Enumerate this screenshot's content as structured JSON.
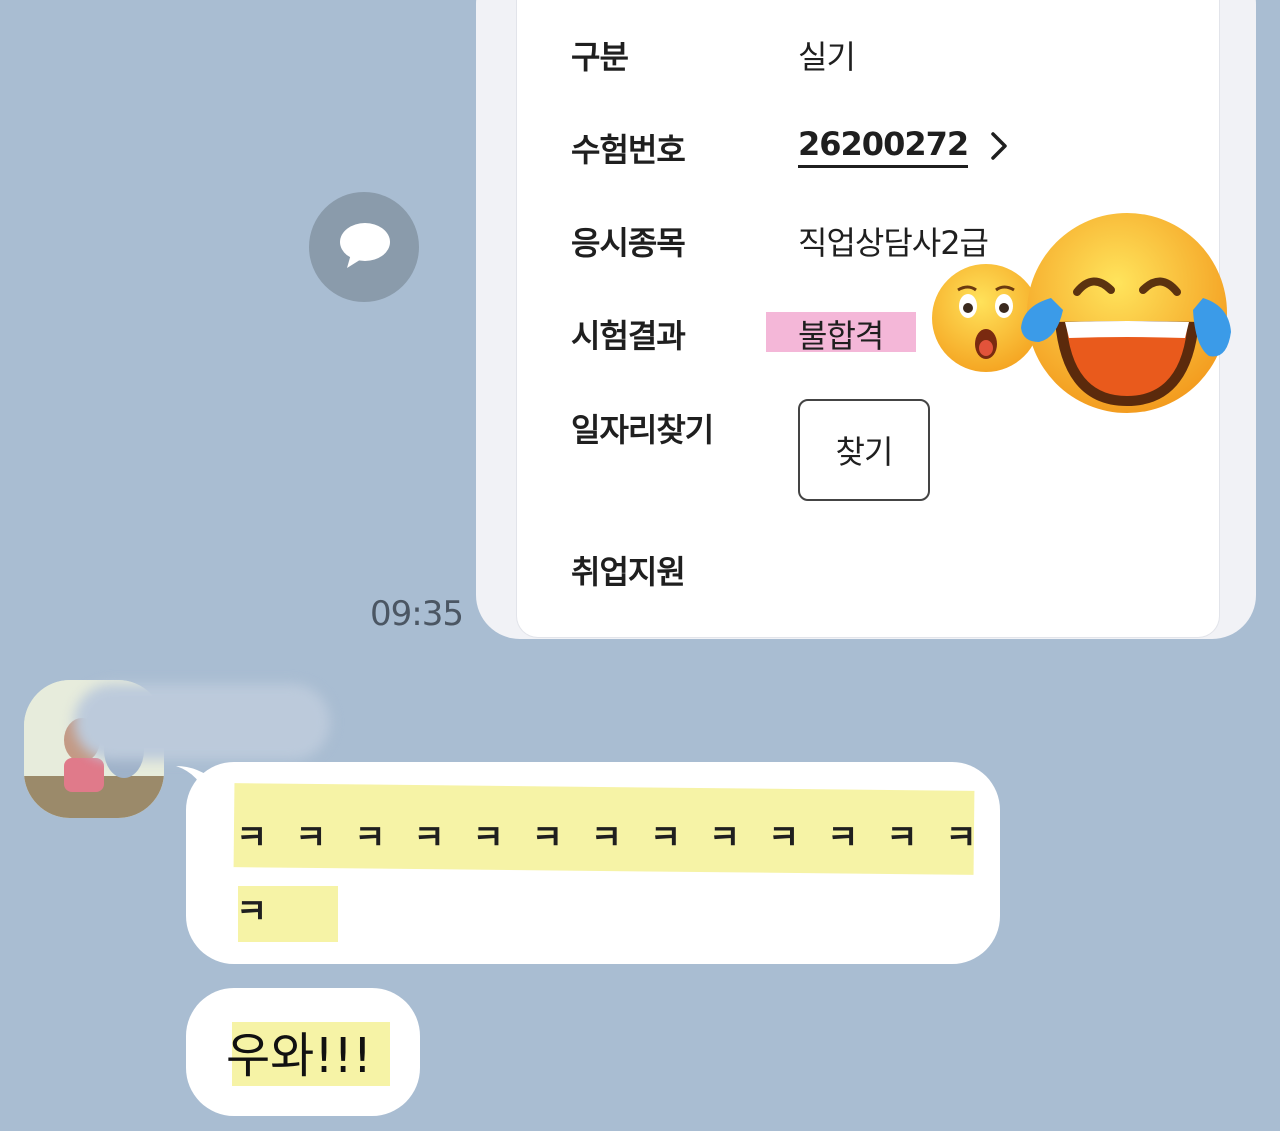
{
  "result_card": {
    "rows": [
      {
        "label": "구분",
        "value": "실기"
      },
      {
        "label": "수험번호",
        "value": "26200272"
      },
      {
        "label": "응시종목",
        "value": "직업상담사2급"
      },
      {
        "label": "시험결과",
        "value": "불합격"
      },
      {
        "label": "일자리찾기",
        "button": "찾기"
      },
      {
        "label": "취업지원"
      }
    ]
  },
  "message_time": "09:35",
  "incoming": {
    "message_1_line_1": "ㅋ ㅋ ㅋ ㅋ ㅋ ㅋ ㅋ ㅋ ㅋ ㅋ ㅋ ㅋ ㅋ",
    "message_1_line_2": "ㅋ",
    "message_2": "우와!!!"
  },
  "colors": {
    "chat_background": "#a9bdd2",
    "highlight_pink": "#f4b7d8",
    "highlight_yellow": "#f6f3a6"
  },
  "icons": [
    "chat-bubble-icon",
    "chevron-right-icon",
    "surprised-face-emoji",
    "tears-of-joy-emoji"
  ]
}
